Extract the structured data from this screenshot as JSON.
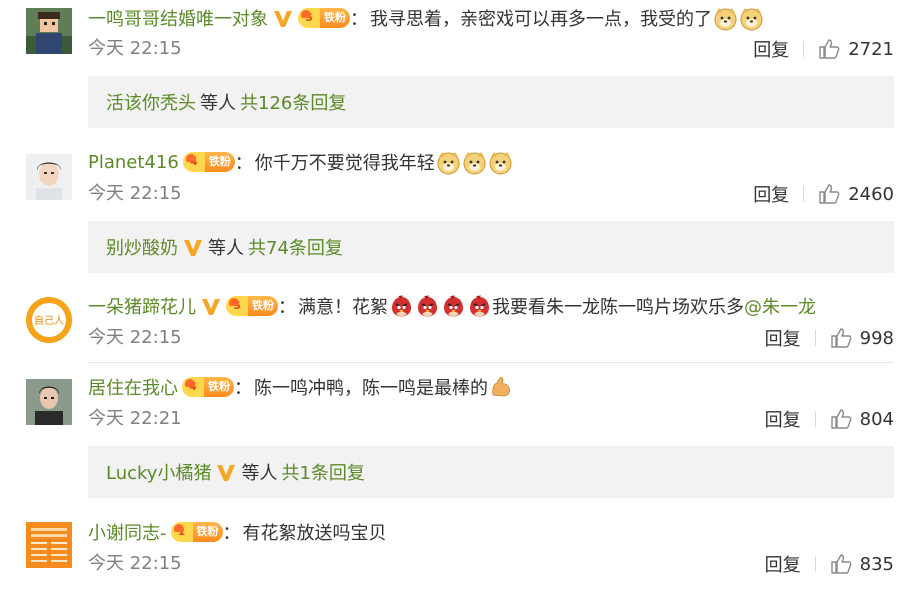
{
  "comments": [
    {
      "user": "一鸣哥哥结婚唯一对象",
      "fan_level": "5",
      "fan_label": "铁粉",
      "text": "我寻思着，亲密戏可以再多一点，我受的了",
      "time": "今天 22:15",
      "reply_label": "回复",
      "likes": "2721",
      "replies": {
        "user": "活该你秃头",
        "mid": "等人",
        "count": "共126条回复"
      }
    },
    {
      "user": "Planet416",
      "fan_level": "4",
      "fan_label": "铁粉",
      "text": "你千万不要觉得我年轻",
      "time": "今天 22:15",
      "reply_label": "回复",
      "likes": "2460",
      "replies": {
        "user": "别炒酸奶",
        "mid": "等人",
        "count": "共74条回复"
      }
    },
    {
      "user": "一朵猪蹄花儿",
      "fan_level": "5",
      "fan_label": "铁粉",
      "text_a": "满意！花絮",
      "text_b": "我要看朱一龙陈一鸣片场欢乐多",
      "mention": "@朱一龙",
      "avatar_text": "自己人",
      "time": "今天 22:15",
      "reply_label": "回复",
      "likes": "998"
    },
    {
      "user": "居住在我心",
      "fan_level": "4",
      "fan_label": "铁粉",
      "text": "陈一鸣冲鸭，陈一鸣是最棒的",
      "time": "今天 22:21",
      "reply_label": "回复",
      "likes": "804",
      "replies": {
        "user": "Lucky小橘猪",
        "mid": "等人",
        "count": "共1条回复"
      }
    },
    {
      "user": "小谢同志-",
      "fan_level": "1",
      "fan_label": "铁粉",
      "text": "有花絮放送吗宝贝",
      "time": "今天 22:15",
      "reply_label": "回复",
      "likes": "835"
    }
  ],
  "colors": {
    "username": "#5b8a27",
    "reply_bg": "#f2f2f2",
    "verified": "#f5a623"
  }
}
